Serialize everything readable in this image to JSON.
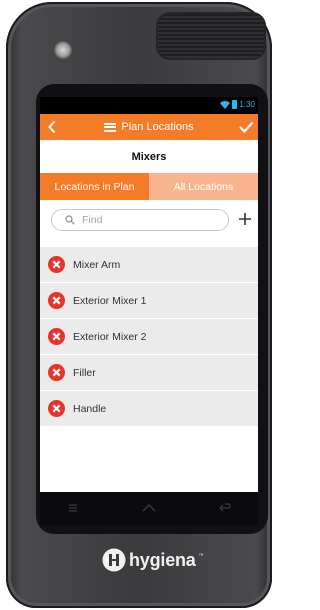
{
  "device": {
    "brand": "hygiena",
    "trademark": "™"
  },
  "status_bar": {
    "time": "1:30"
  },
  "title_bar": {
    "title": "Plan Locations"
  },
  "subheader": {
    "title": "Mixers"
  },
  "tabs": [
    {
      "label": "Locations in Plan",
      "active": true
    },
    {
      "label": "All Locations",
      "active": false
    }
  ],
  "search": {
    "placeholder": "Find",
    "value": ""
  },
  "locations": [
    {
      "label": "Mixer Arm"
    },
    {
      "label": "Exterior Mixer 1"
    },
    {
      "label": "Exterior Mixer 2"
    },
    {
      "label": "Filler"
    },
    {
      "label": "Handle"
    }
  ],
  "colors": {
    "accent": "#f47b28",
    "accent_light": "#f8b48e",
    "remove": "#e8332a",
    "status": "#29b6f6",
    "list_bg": "#ebebeb"
  },
  "icons": {
    "back": "chevron-left-icon",
    "menu": "menu-icon",
    "check": "check-icon",
    "search": "search-icon",
    "add": "plus-icon",
    "remove": "remove-circle-icon",
    "nav": [
      "recent-apps-icon",
      "home-icon",
      "back-icon"
    ]
  }
}
